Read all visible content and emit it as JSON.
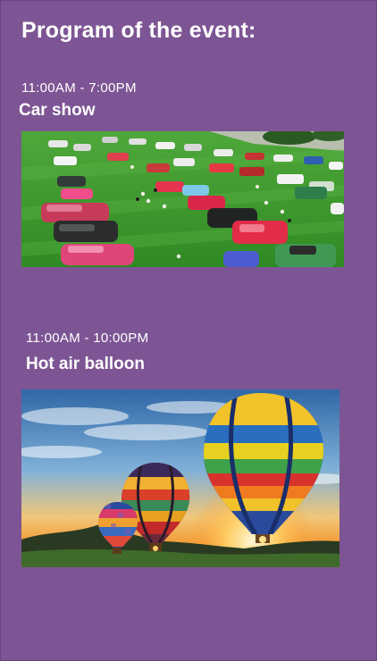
{
  "page": {
    "title": "Program of the event:"
  },
  "events": [
    {
      "time": "11:00AM - 7:00PM",
      "name": "Car show",
      "image": "car-show-photo"
    },
    {
      "time": "11:00AM - 10:00PM",
      "name": "Hot air balloon",
      "image": "hot-air-balloon-photo"
    }
  ],
  "colors": {
    "background": "#7d5594",
    "text": "#ffffff",
    "grass": "#3f9a2f",
    "sky_top": "#3a6fb0",
    "sunset": "#f2a23a"
  }
}
